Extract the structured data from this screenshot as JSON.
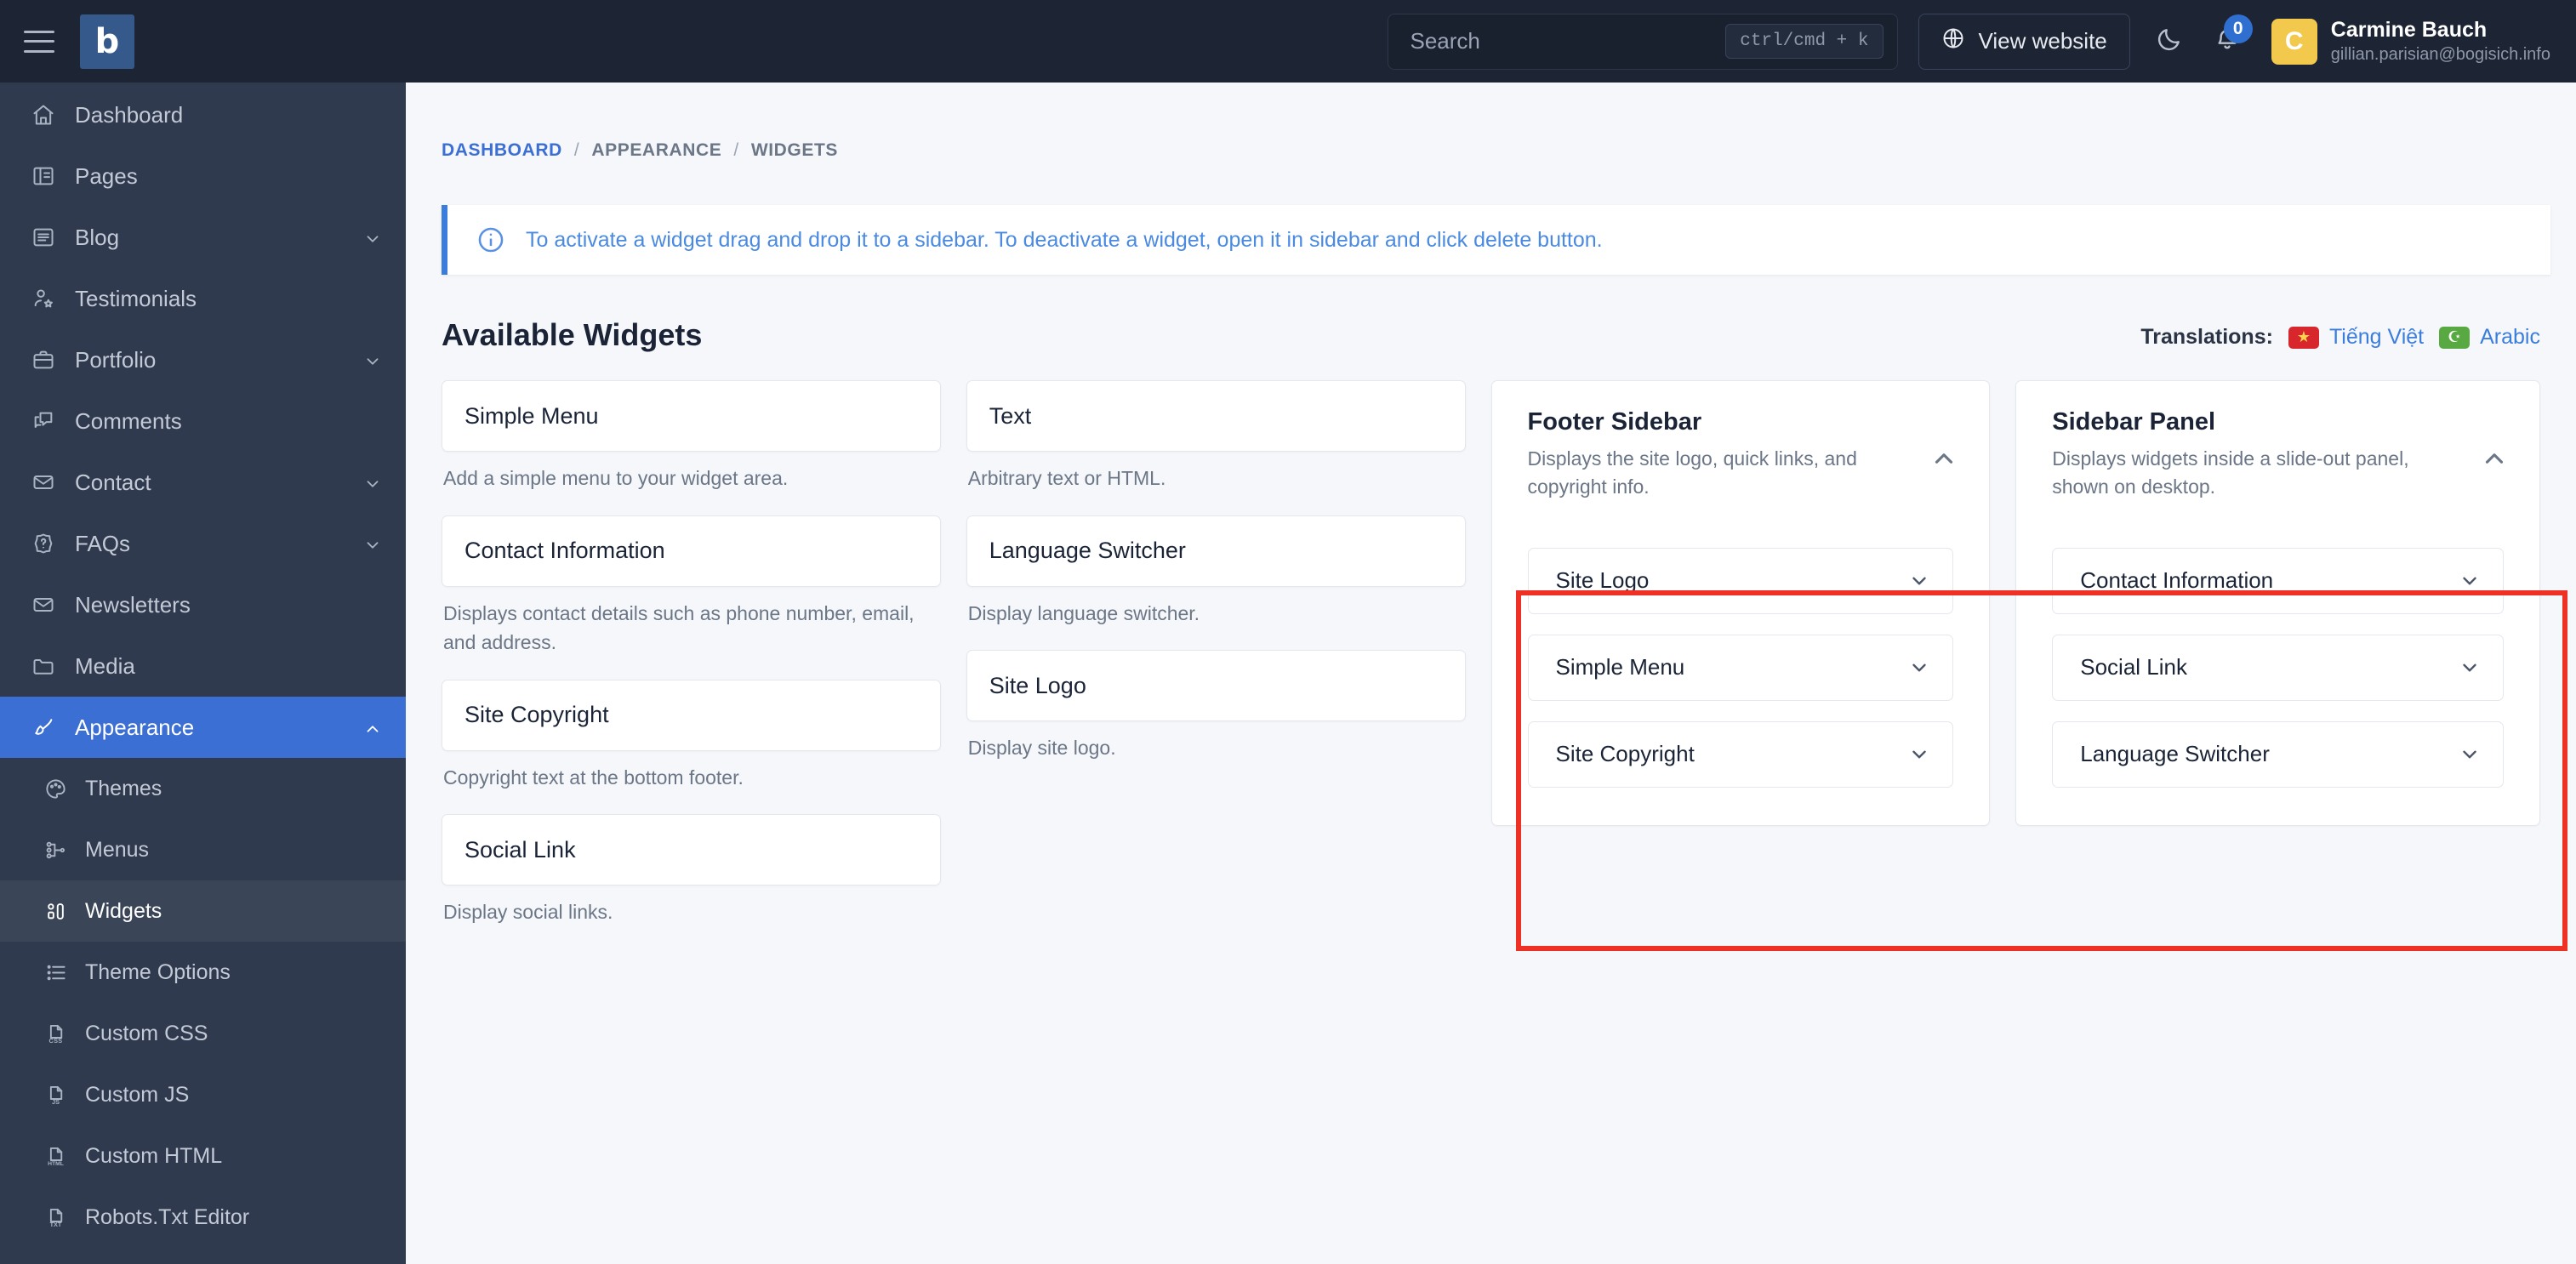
{
  "brand": {
    "logo_letter": "b",
    "menu_icon": "hamburger-icon"
  },
  "topbar": {
    "search": {
      "placeholder": "Search",
      "shortcut": "ctrl/cmd + k"
    },
    "view_website_label": "View website",
    "dark_mode_icon": "moon-icon",
    "notifications": {
      "icon": "bell-icon",
      "count": "0"
    },
    "user": {
      "avatar_initial": "C",
      "name": "Carmine Bauch",
      "email": "gillian.parisian@bogisich.info"
    }
  },
  "sidebar": {
    "items": [
      {
        "label": "Dashboard",
        "icon": "home-icon",
        "expandable": false,
        "active": false
      },
      {
        "label": "Pages",
        "icon": "book-icon",
        "expandable": false,
        "active": false
      },
      {
        "label": "Blog",
        "icon": "article-icon",
        "expandable": true,
        "active": false
      },
      {
        "label": "Testimonials",
        "icon": "user-star-icon",
        "expandable": false,
        "active": false
      },
      {
        "label": "Portfolio",
        "icon": "briefcase-icon",
        "expandable": true,
        "active": false
      },
      {
        "label": "Comments",
        "icon": "comments-icon",
        "expandable": false,
        "active": false
      },
      {
        "label": "Contact",
        "icon": "envelope-icon",
        "expandable": true,
        "active": false
      },
      {
        "label": "FAQs",
        "icon": "question-badge-icon",
        "expandable": true,
        "active": false
      },
      {
        "label": "Newsletters",
        "icon": "envelope-icon",
        "expandable": false,
        "active": false
      },
      {
        "label": "Media",
        "icon": "folder-icon",
        "expandable": false,
        "active": false
      },
      {
        "label": "Appearance",
        "icon": "brush-icon",
        "expandable": true,
        "active": true
      }
    ],
    "subitems": [
      {
        "label": "Themes",
        "icon": "palette-icon",
        "active": false
      },
      {
        "label": "Menus",
        "icon": "sitemap-icon",
        "active": false
      },
      {
        "label": "Widgets",
        "icon": "widgets-icon",
        "active": true
      },
      {
        "label": "Theme Options",
        "icon": "list-icon",
        "active": false
      },
      {
        "label": "Custom CSS",
        "icon": "file-css-icon",
        "tag": "CSS",
        "active": false
      },
      {
        "label": "Custom JS",
        "icon": "file-js-icon",
        "tag": "JS",
        "active": false
      },
      {
        "label": "Custom HTML",
        "icon": "file-html-icon",
        "tag": "HTML",
        "active": false
      },
      {
        "label": "Robots.Txt Editor",
        "icon": "file-txt-icon",
        "tag": "TXT",
        "active": false
      }
    ]
  },
  "breadcrumb": {
    "root": "DASHBOARD",
    "sep": "/",
    "mid": "APPEARANCE",
    "current": "WIDGETS"
  },
  "notice": {
    "icon": "info-circle-icon",
    "text": "To activate a widget drag and drop it to a sidebar. To deactivate a widget, open it in sidebar and click delete button."
  },
  "page": {
    "title": "Available Widgets"
  },
  "translations": {
    "label": "Translations:",
    "items": [
      {
        "name": "Tiếng Việt",
        "flag": "vietnam-flag-icon",
        "glyph": "★"
      },
      {
        "name": "Arabic",
        "flag": "saudi-arabia-flag-icon",
        "glyph": "☪"
      }
    ]
  },
  "available_widgets": {
    "column_1": [
      {
        "name": "Simple Menu",
        "description": "Add a simple menu to your widget area."
      },
      {
        "name": "Contact Information",
        "description": "Displays contact details such as phone number, email, and address."
      },
      {
        "name": "Site Copyright",
        "description": "Copyright text at the bottom footer."
      },
      {
        "name": "Social Link",
        "description": "Display social links."
      }
    ],
    "column_2": [
      {
        "name": "Text",
        "description": "Arbitrary text or HTML."
      },
      {
        "name": "Language Switcher",
        "description": "Display language switcher."
      },
      {
        "name": "Site Logo",
        "description": "Display site logo."
      }
    ]
  },
  "sidebars": [
    {
      "title": "Footer Sidebar",
      "description": "Displays the site logo, quick links, and copyright info.",
      "toggle_icon": "chevron-up-icon",
      "widgets": [
        {
          "name": "Site Logo",
          "chevron": "chevron-down-icon"
        },
        {
          "name": "Simple Menu",
          "chevron": "chevron-down-icon"
        },
        {
          "name": "Site Copyright",
          "chevron": "chevron-down-icon"
        }
      ]
    },
    {
      "title": "Sidebar Panel",
      "description": "Displays widgets inside a slide-out panel, shown on desktop.",
      "toggle_icon": "chevron-up-icon",
      "widgets": [
        {
          "name": "Contact Information",
          "chevron": "chevron-down-icon"
        },
        {
          "name": "Social Link",
          "chevron": "chevron-down-icon"
        },
        {
          "name": "Language Switcher",
          "chevron": "chevron-down-icon"
        }
      ]
    }
  ],
  "colors": {
    "sidebar_bg": "#2f3a4f",
    "topbar_bg": "#1d2433",
    "accent_blue": "#3b6fd4",
    "link_blue": "#3b7ddd",
    "highlight_red": "#ee3124",
    "avatar_yellow": "#f2c94c",
    "content_bg": "#f5f7fa"
  }
}
